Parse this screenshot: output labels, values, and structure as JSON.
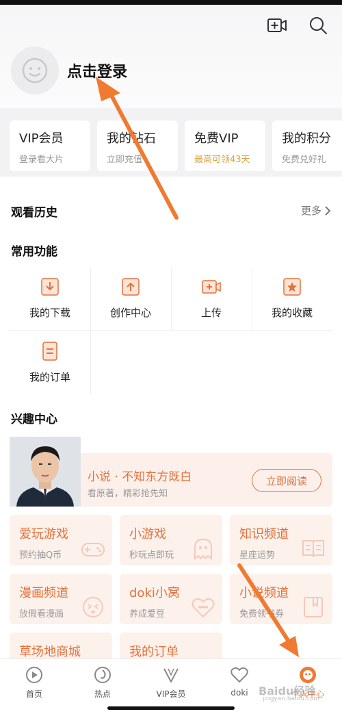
{
  "header": {
    "login_text": "点击登录"
  },
  "vip_cards": [
    {
      "title": "VIP会员",
      "subtitle": "登录看大片"
    },
    {
      "title": "我的钻石",
      "subtitle": "立即充值"
    },
    {
      "title": "免费VIP",
      "subtitle": "最高可领43天"
    },
    {
      "title": "我的积分",
      "subtitle": "免费兑好礼"
    }
  ],
  "history": {
    "title": "观看历史",
    "more": "更多"
  },
  "functions": {
    "title": "常用功能",
    "items": [
      {
        "label": "我的下载",
        "icon": "download-icon"
      },
      {
        "label": "创作中心",
        "icon": "upload-box-icon"
      },
      {
        "label": "上传",
        "icon": "video-add-icon"
      },
      {
        "label": "我的收藏",
        "icon": "star-box-icon"
      },
      {
        "label": "我的订单",
        "icon": "order-icon"
      }
    ]
  },
  "interest": {
    "title": "兴趣中心",
    "banner": {
      "title": "小说 · 不知东方既白",
      "subtitle": "看原著，精彩抢先知",
      "button": "立即阅读"
    },
    "cards": [
      {
        "title": "爱玩游戏",
        "subtitle": "预约抽Q币"
      },
      {
        "title": "小游戏",
        "subtitle": "秒玩点即玩"
      },
      {
        "title": "知识频道",
        "subtitle": "星座运势"
      },
      {
        "title": "漫画频道",
        "subtitle": "放假看漫画"
      },
      {
        "title": "doki小窝",
        "subtitle": "养成爱豆"
      },
      {
        "title": "小说频道",
        "subtitle": "免费领书券"
      },
      {
        "title": "草场地商城",
        "subtitle": ""
      },
      {
        "title": "我的订单",
        "subtitle": ""
      }
    ]
  },
  "bottom_nav": [
    {
      "label": "首页"
    },
    {
      "label": "热点"
    },
    {
      "label": "VIP会员"
    },
    {
      "label": "doki"
    },
    {
      "label": "个人中心"
    }
  ],
  "watermark": {
    "text": "Baidu经验",
    "url": "jingyan.baidu.com"
  },
  "colors": {
    "accent": "#e4703a",
    "arrow": "#f07a30",
    "gold": "#d9a441"
  }
}
